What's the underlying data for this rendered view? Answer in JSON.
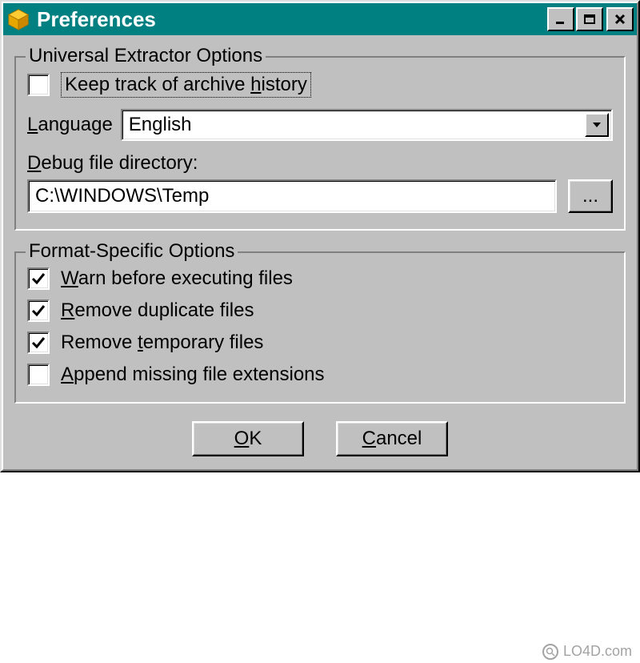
{
  "window": {
    "title": "Preferences"
  },
  "groups": {
    "universal": {
      "legend": "Universal Extractor Options",
      "keep_history": {
        "label_pre": "Keep track of archive ",
        "label_key": "h",
        "label_post": "istory",
        "checked": false
      },
      "language": {
        "label_pre": "",
        "label_key": "L",
        "label_post": "anguage",
        "value": "English"
      },
      "debug_dir": {
        "label_pre": "",
        "label_key": "D",
        "label_post": "ebug file directory:",
        "value": "C:\\WINDOWS\\Temp",
        "browse_label": "..."
      }
    },
    "format": {
      "legend": "Format-Specific Options",
      "warn": {
        "label_pre": "",
        "label_key": "W",
        "label_post": "arn before executing files",
        "checked": true
      },
      "remove_dup": {
        "label_pre": "",
        "label_key": "R",
        "label_post": "emove duplicate files",
        "checked": true
      },
      "remove_temp": {
        "label_pre": "Remove ",
        "label_key": "t",
        "label_post": "emporary files",
        "checked": true
      },
      "append_ext": {
        "label_pre": "",
        "label_key": "A",
        "label_post": "ppend missing file extensions",
        "checked": false
      }
    }
  },
  "buttons": {
    "ok_pre": "",
    "ok_key": "O",
    "ok_post": "K",
    "cancel_pre": "",
    "cancel_key": "C",
    "cancel_post": "ancel"
  },
  "watermark": "LO4D.com"
}
